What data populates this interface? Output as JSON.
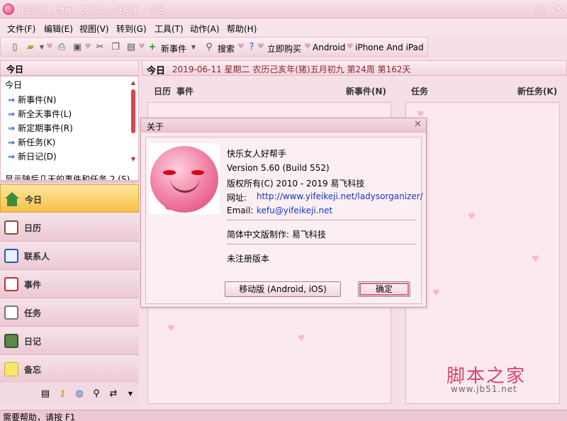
{
  "window": {
    "title": "我的信息.effw - 快乐女人好帮手 - 今日"
  },
  "window_controls": {
    "minimize": "–",
    "maximize": "□",
    "close": "✕"
  },
  "menu": [
    "文件(F)",
    "编辑(E)",
    "视图(V)",
    "转到(G)",
    "工具(T)",
    "动作(A)",
    "帮助(H)"
  ],
  "toolbar": {
    "new_event": "新事件",
    "search": "搜索",
    "buy_now": "立即购买",
    "android": "Android",
    "ios": "iPhone And iPad",
    "icons": [
      "new-file-icon",
      "open-folder-icon",
      "print-icon",
      "preview-icon",
      "cut-icon",
      "copy-icon",
      "paste-icon",
      "add-icon",
      "search-icon",
      "help-icon"
    ]
  },
  "left_panel": {
    "header": "今日",
    "list_title": "今日",
    "links": [
      "新事件(N)",
      "新全天事件(L)",
      "新定期事件(R)",
      "新任务(K)",
      "新日记(D)"
    ],
    "cutoff": "显示随后几天的事件和任务 2 (S)",
    "nav": [
      "今日",
      "日历",
      "联系人",
      "事件",
      "任务",
      "日记",
      "备忘"
    ]
  },
  "date_bar": {
    "label": "今日",
    "text": "2019-06-11 星期二 农历己亥年(猪)五月初九  第24周 第162天"
  },
  "calendar_column": {
    "label": "日历",
    "sub": "事件",
    "new": "新事件(N)"
  },
  "task_column": {
    "label": "任务",
    "new": "新任务(K)"
  },
  "dialog": {
    "title": "关于",
    "close": "✕",
    "app_name": "快乐女人好帮手",
    "version": "Version 5.60 (Build 552)",
    "copyright": "版权所有(C) 2010 - 2019 易飞科技",
    "website_label": "网址:",
    "website": "http://www.yifeikeji.net/ladysorganizer/",
    "email_label": "Email:",
    "email": "kefu@yifeikeji.net",
    "localized_by": "简体中文版制作: 易飞科技",
    "registration": "未注册版本",
    "mobile_button": "移动版 (Android, iOS)",
    "ok_button": "确定"
  },
  "watermark": {
    "title": "脚本之家",
    "url": "www.jb51.net"
  },
  "status": "需要帮助，请按 F1"
}
